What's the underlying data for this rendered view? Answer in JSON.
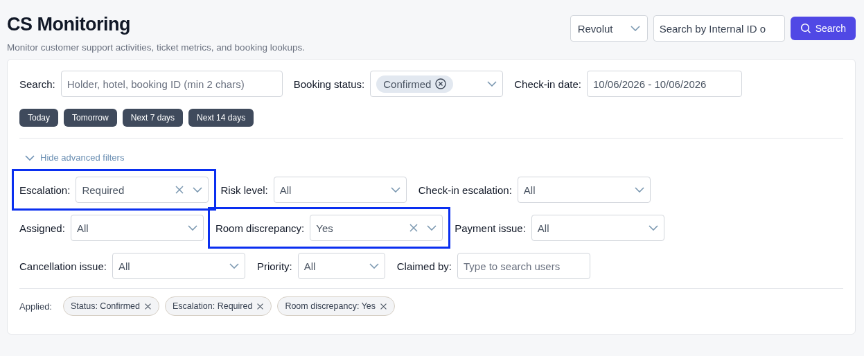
{
  "header": {
    "title": "CS Monitoring",
    "subtitle": "Monitor customer support activities, ticket metrics, and booking lookups."
  },
  "toolbar": {
    "provider": "Revolut",
    "search_placeholder": "Search by Internal ID o",
    "search_button": "Search"
  },
  "search_row": [
    {
      "kind": "text",
      "label": "Search:",
      "placeholder": "Holder, hotel, booking ID (min 2 chars)"
    },
    {
      "kind": "tags",
      "label": "Booking status:",
      "tags": [
        "Confirmed"
      ]
    },
    {
      "kind": "date",
      "label": "Check-in date:",
      "value": "10/06/2026 - 10/06/2026"
    }
  ],
  "quick_ranges": [
    "Today",
    "Tomorrow",
    "Next 7 days",
    "Next 14 days"
  ],
  "advanced_toggle": {
    "label": "Hide advanced filters",
    "expanded": true
  },
  "advanced_rows": [
    {
      "filters": [
        {
          "kind": "select",
          "label": "Escalation:",
          "value": "Required",
          "clearable": true,
          "highlighted": true
        },
        {
          "kind": "select",
          "label": "Risk level:",
          "value": "All",
          "clearable": false,
          "highlighted": false
        },
        {
          "kind": "select",
          "label": "Check-in escalation:",
          "value": "All",
          "clearable": false,
          "highlighted": false
        }
      ]
    },
    {
      "filters": [
        {
          "kind": "select",
          "label": "Assigned:",
          "value": "All",
          "clearable": false,
          "highlighted": false
        },
        {
          "kind": "select",
          "label": "Room discrepancy:",
          "value": "Yes",
          "clearable": true,
          "highlighted": true
        },
        {
          "kind": "select",
          "label": "Payment issue:",
          "value": "All",
          "clearable": false,
          "highlighted": false
        }
      ]
    },
    {
      "filters": [
        {
          "kind": "select",
          "label": "Cancellation issue:",
          "value": "All",
          "clearable": false,
          "highlighted": false
        },
        {
          "kind": "select",
          "label": "Priority:",
          "value": "All",
          "clearable": false,
          "highlighted": false
        },
        {
          "kind": "text",
          "label": "Claimed by:",
          "placeholder": "Type to search users",
          "highlighted": false
        }
      ]
    }
  ],
  "applied": {
    "label": "Applied:",
    "chips": [
      "Status: Confirmed",
      "Escalation: Required",
      "Room discrepancy: Yes"
    ]
  }
}
